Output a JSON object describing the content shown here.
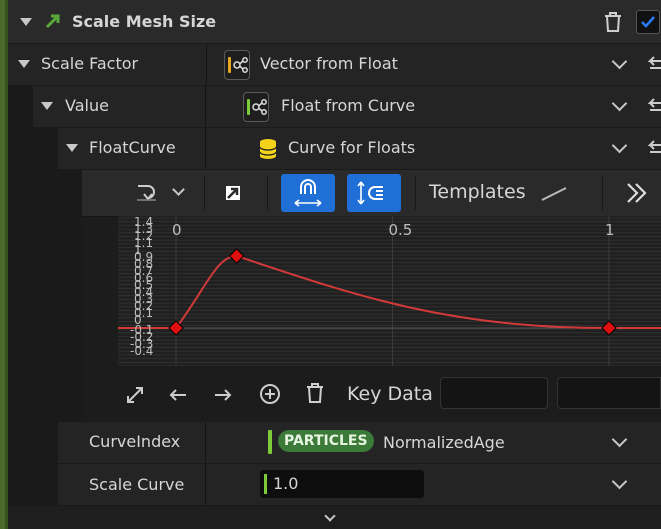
{
  "header": {
    "title": "Scale Mesh Size"
  },
  "rows": {
    "scale_factor": {
      "label": "Scale Factor",
      "value": "Vector from Float"
    },
    "value": {
      "label": "Value",
      "value": "Float from Curve"
    },
    "float_curve": {
      "label": "FloatCurve",
      "value": "Curve for Floats"
    },
    "curve_index": {
      "label": "CurveIndex",
      "badge": "PARTICLES",
      "value": "NormalizedAge"
    },
    "scale_curve": {
      "label": "Scale Curve",
      "value": "1.0"
    }
  },
  "curve_toolbar": {
    "templates_label": "Templates"
  },
  "curve_editor": {
    "x_ticks": [
      "0",
      "0.5",
      "1"
    ],
    "y_ticks_top": [
      "1.4",
      "1.3",
      "1.2",
      "1.1",
      "1",
      "0.9",
      "0.8",
      "0.7",
      "0.6",
      "0.5",
      "0.4",
      "0.3",
      "0.2",
      "0.1",
      "0"
    ],
    "y_ticks_bottom": [
      "-0.1",
      "-0.2",
      "-0.3",
      "-0.4"
    ],
    "curve_color": "#d23a3a",
    "keys": [
      {
        "time": 0,
        "value": 0
      },
      {
        "time": 0.14,
        "value": 1.0
      },
      {
        "time": 1,
        "value": 0
      }
    ]
  },
  "key_toolbar": {
    "key_data_label": "Key Data"
  },
  "colors": {
    "accent_green": "#4b6a2a",
    "blue_button": "#1f6fd6",
    "badge_green": "#3c7a3a",
    "checkbox_blue": "#2a7bff"
  }
}
